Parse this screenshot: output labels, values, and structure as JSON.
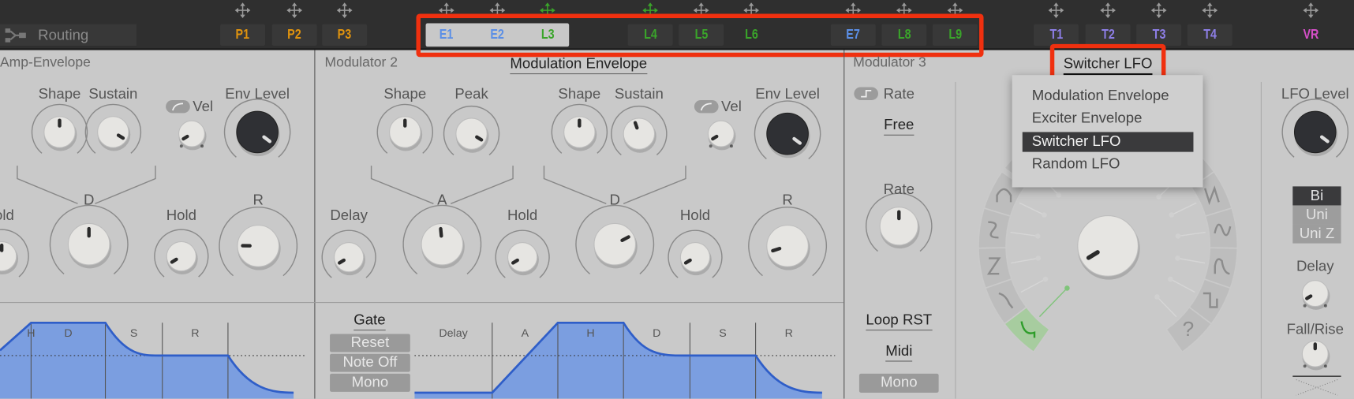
{
  "topbar": {
    "routing_label": "Routing",
    "slots": [
      {
        "label": "P1",
        "color": "#e0930e",
        "move_color": "#9a9a9a"
      },
      {
        "label": "P2",
        "color": "#e0930e",
        "move_color": "#9a9a9a"
      },
      {
        "label": "P3",
        "color": "#e0930e",
        "move_color": "#9a9a9a"
      },
      {
        "label": "E1",
        "color": "#5b8fe6",
        "move_color": "#9a9a9a"
      },
      {
        "label": "E2",
        "color": "#5b8fe6",
        "move_color": "#9a9a9a"
      },
      {
        "label": "L3",
        "color": "#3aa52a",
        "move_color": "#3aa52a"
      },
      {
        "label": "L4",
        "color": "#3aa52a",
        "move_color": "#3aa52a"
      },
      {
        "label": "L5",
        "color": "#3aa52a",
        "move_color": "#9a9a9a"
      },
      {
        "label": "L6",
        "color": "#3aa52a",
        "move_color": "#9a9a9a"
      },
      {
        "label": "E7",
        "color": "#5b8fe6",
        "move_color": "#9a9a9a"
      },
      {
        "label": "L8",
        "color": "#3aa52a",
        "move_color": "#9a9a9a"
      },
      {
        "label": "L9",
        "color": "#3aa52a",
        "move_color": "#9a9a9a"
      },
      {
        "label": "T1",
        "color": "#8d7ee6",
        "move_color": "#9a9a9a"
      },
      {
        "label": "T2",
        "color": "#8d7ee6",
        "move_color": "#9a9a9a"
      },
      {
        "label": "T3",
        "color": "#8d7ee6",
        "move_color": "#9a9a9a"
      },
      {
        "label": "T4",
        "color": "#8d7ee6",
        "move_color": "#9a9a9a"
      },
      {
        "label": "VR",
        "color": "#d64fc8",
        "move_color": "#9a9a9a"
      }
    ],
    "highlight_color": "#f0300f"
  },
  "amp": {
    "title": "Amp-Envelope",
    "vel_label": "Vel",
    "partial_hold_label": "old",
    "knobs": {
      "shape": {
        "label": "Shape",
        "value": 0.5
      },
      "sustain": {
        "label": "Sustain",
        "value": 0.95
      },
      "vel": {
        "label": "",
        "value": 0.05
      },
      "env_level": {
        "label": "Env Level",
        "value": 0.97
      },
      "hold_a": {
        "label": "",
        "value": 0.5
      },
      "d": {
        "label": "D",
        "value": 0.5
      },
      "hold": {
        "label": "Hold",
        "value": 0.05
      },
      "r": {
        "label": "R",
        "value": 0.17
      }
    },
    "env_segments": [
      "H",
      "D",
      "S",
      "R"
    ]
  },
  "mod2": {
    "title": "Modulator 2",
    "type": "Modulation Envelope",
    "vel_label": "Vel",
    "knobs": {
      "shape1": {
        "label": "Shape",
        "value": 0.5
      },
      "peak": {
        "label": "Peak",
        "value": 0.95
      },
      "shape2": {
        "label": "Shape",
        "value": 0.5
      },
      "sustain": {
        "label": "Sustain",
        "value": 0.43
      },
      "vel": {
        "label": "",
        "value": 0.05
      },
      "env_level": {
        "label": "Env Level",
        "value": 0.97
      },
      "delay": {
        "label": "Delay",
        "value": 0.05
      },
      "a": {
        "label": "A",
        "value": 0.48
      },
      "hold1": {
        "label": "Hold",
        "value": 0.05
      },
      "d": {
        "label": "D",
        "value": 0.73
      },
      "hold2": {
        "label": "Hold",
        "value": 0.05
      },
      "r": {
        "label": "R",
        "value": 0.1
      }
    },
    "gate_label": "Gate",
    "gate_buttons": [
      "Reset",
      "Note Off",
      "Mono"
    ],
    "env_segments": [
      "Delay",
      "A",
      "H",
      "D",
      "S",
      "R"
    ]
  },
  "mod3": {
    "title": "Modulator 3",
    "type": "Switcher LFO",
    "rate_toggle_label": "Rate",
    "sync_mode": "Free",
    "loop_label": "Loop RST",
    "midi_label": "Midi",
    "mono_label": "Mono",
    "knobs": {
      "rate": {
        "label": "Rate",
        "value": 0.5
      },
      "switch": {
        "label": "",
        "value": 0.05
      },
      "lfo_level": {
        "label": "LFO Level",
        "value": 0.97
      },
      "delay": {
        "label": "Delay",
        "value": 0.05
      },
      "fall_rise": {
        "label": "Fall/Rise",
        "value": 0.5
      }
    },
    "polarity_options": [
      "Bi",
      "Uni",
      "Uni Z"
    ],
    "polarity_selected": "Bi",
    "waveforms_left": [
      "arch-wave-icon",
      "s-curve-wave-icon",
      "zigzag-wave-icon",
      "ramp-curve-wave-icon",
      "hook-wave-icon"
    ],
    "waveforms_right": [
      "triangle-wave-icon",
      "sine-wave-icon",
      "decay-pulse-wave-icon",
      "square-wave-icon",
      "random-wave-icon"
    ],
    "selected_waveform": "hook-wave-icon",
    "selected_color": "#2e9d2a",
    "dropdown": {
      "items": [
        "Modulation Envelope",
        "Exciter Envelope",
        "Switcher LFO",
        "Random LFO"
      ],
      "selected": "Switcher LFO"
    }
  },
  "envelope_fill": "#7b9ee0",
  "envelope_line": "#2f5ec8"
}
